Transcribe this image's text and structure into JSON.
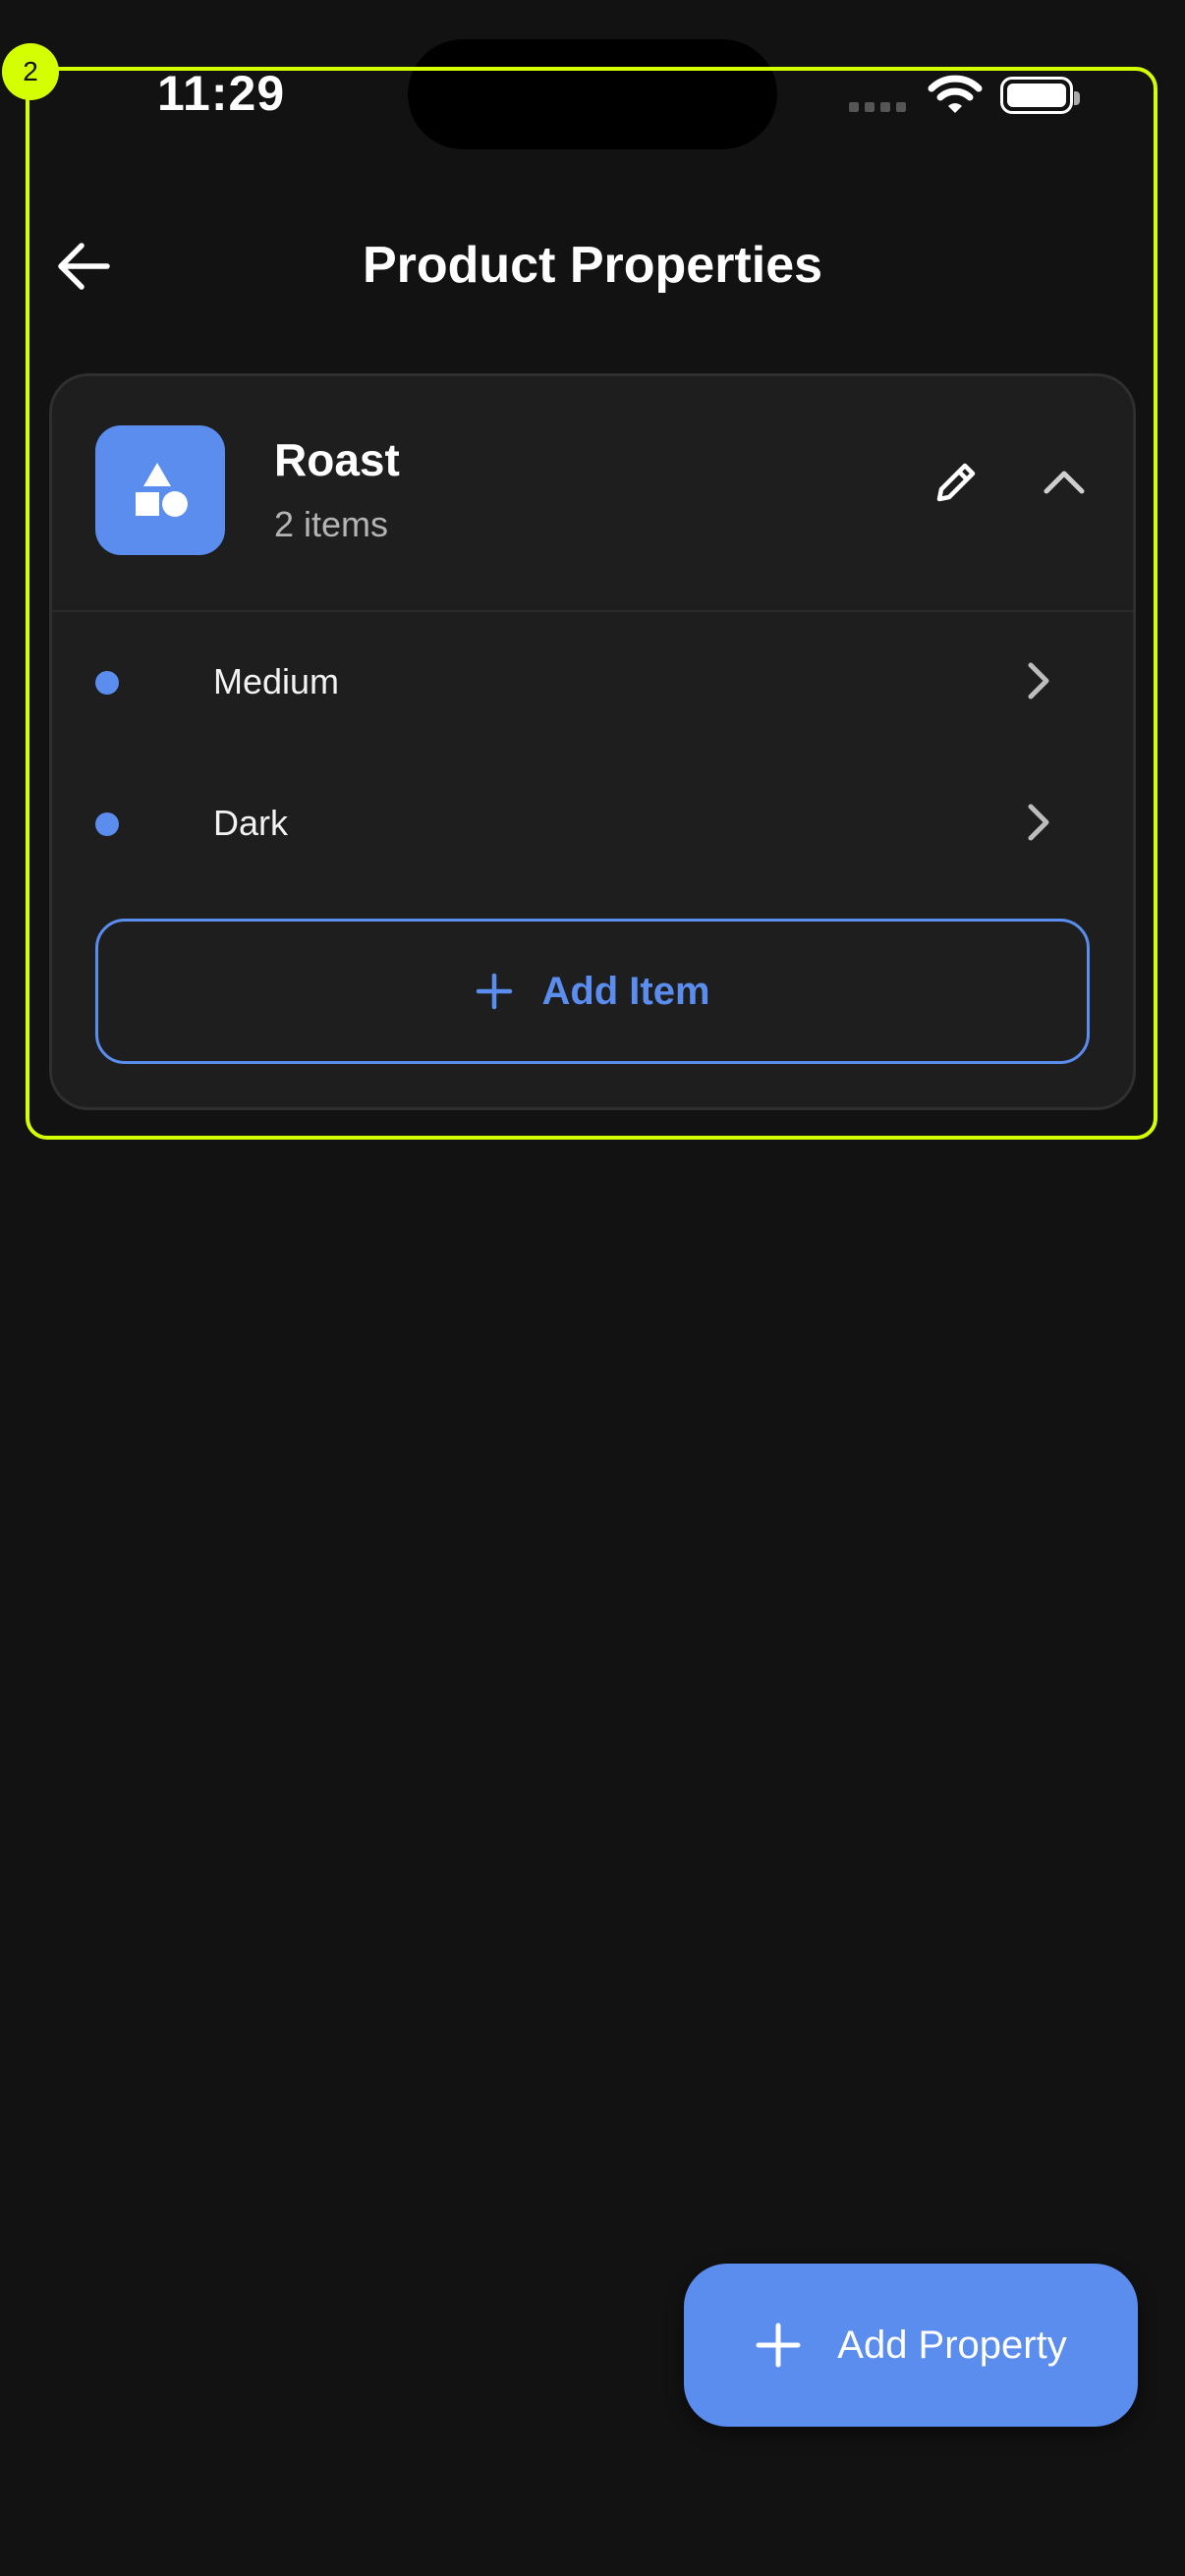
{
  "status_bar": {
    "time": "11:29"
  },
  "annotation": {
    "badge": "2"
  },
  "header": {
    "title": "Product Properties"
  },
  "property_card": {
    "name": "Roast",
    "count_text": "2 items",
    "items": [
      {
        "label": "Medium"
      },
      {
        "label": "Dark"
      }
    ],
    "add_item_label": "Add Item"
  },
  "fab": {
    "label": "Add Property"
  },
  "colors": {
    "accent": "#5b8def",
    "background": "#121212",
    "card": "#1e1e1e",
    "annotation": "#d4ff00"
  },
  "icons": {
    "back": "arrow-left-icon",
    "property": "shapes-icon",
    "edit": "pencil-icon",
    "collapse": "chevron-up-icon",
    "item": "chevron-right-icon",
    "add": "plus-icon"
  }
}
